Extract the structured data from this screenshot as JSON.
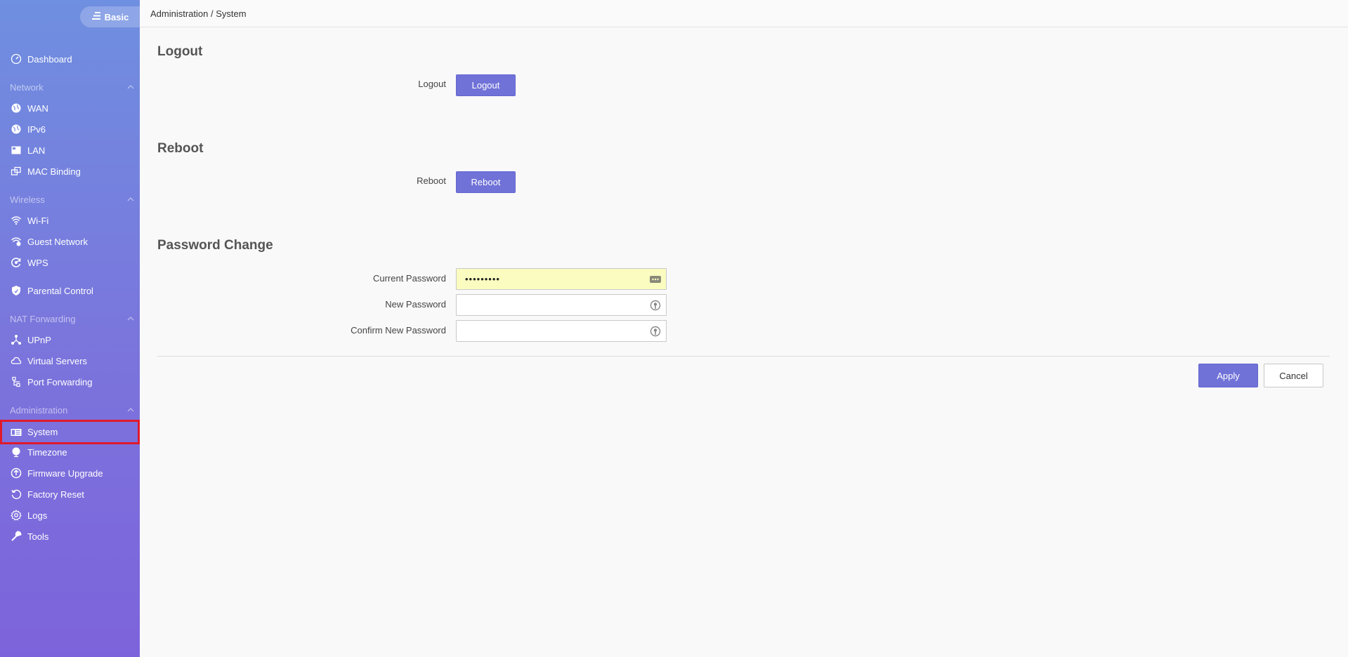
{
  "sidebar": {
    "mode_label": "Basic",
    "items": [
      {
        "label": "Dashboard"
      },
      {
        "section": "Network"
      },
      {
        "label": "WAN"
      },
      {
        "label": "IPv6"
      },
      {
        "label": "LAN"
      },
      {
        "label": "MAC Binding"
      },
      {
        "section": "Wireless"
      },
      {
        "label": "Wi-Fi"
      },
      {
        "label": "Guest Network"
      },
      {
        "label": "WPS"
      },
      {
        "label": "Parental Control"
      },
      {
        "section": "NAT Forwarding"
      },
      {
        "label": "UPnP"
      },
      {
        "label": "Virtual Servers"
      },
      {
        "label": "Port Forwarding"
      },
      {
        "section": "Administration"
      },
      {
        "label": "System"
      },
      {
        "label": "Timezone"
      },
      {
        "label": "Firmware Upgrade"
      },
      {
        "label": "Factory Reset"
      },
      {
        "label": "Logs"
      },
      {
        "label": "Tools"
      }
    ]
  },
  "breadcrumb": "Administration / System",
  "logout": {
    "title": "Logout",
    "label": "Logout",
    "button": "Logout"
  },
  "reboot": {
    "title": "Reboot",
    "label": "Reboot",
    "button": "Reboot"
  },
  "password": {
    "title": "Password Change",
    "current_label": "Current Password",
    "current_value": "•••••••••",
    "new_label": "New Password",
    "new_value": "",
    "confirm_label": "Confirm New Password",
    "confirm_value": ""
  },
  "actions": {
    "apply": "Apply",
    "cancel": "Cancel"
  },
  "colors": {
    "accent": "#7072d8",
    "active_outline": "#e0192b",
    "autofill": "#fafdbf"
  }
}
